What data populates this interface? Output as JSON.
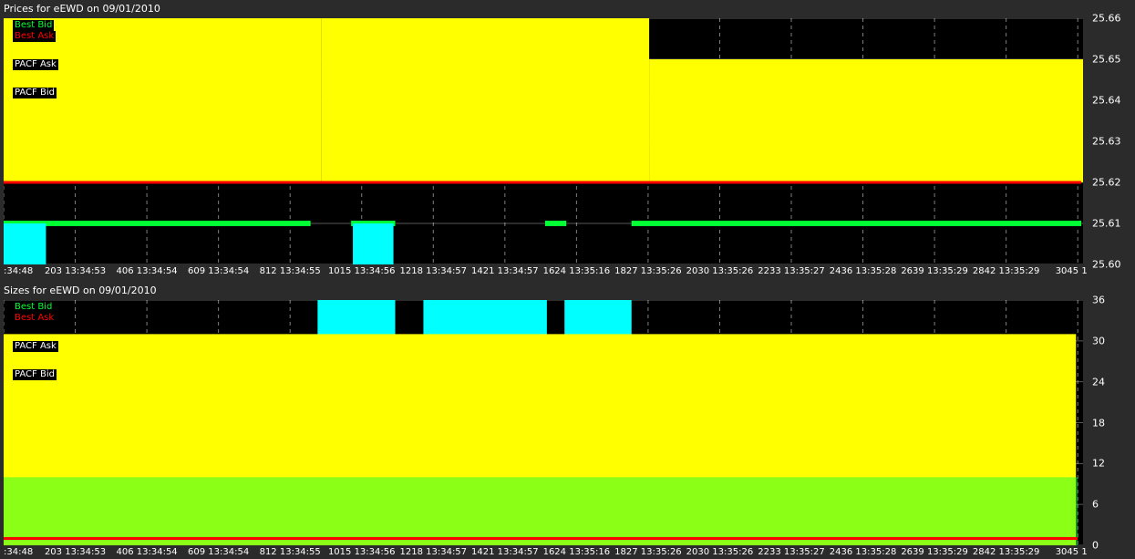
{
  "colors": {
    "ask_fill": "#ffff00",
    "bid_cyan": "#00ffff",
    "best_bid": "#00ff33",
    "best_ask": "#ff0000",
    "grid": "#ffffff",
    "background": "#000000"
  },
  "legend": [
    {
      "label": "Best Bid",
      "color": "#00ff33",
      "text": "#00ff33"
    },
    {
      "label": "Best Ask",
      "color": "#ff0000",
      "text": "#ff0000"
    },
    {
      "label": "PACF Ask",
      "color": "#ffff00",
      "text": "#ffffff"
    },
    {
      "label": "PACF Bid",
      "color": "#00ffff",
      "text": "#ffffff"
    }
  ],
  "chart_data": [
    {
      "type": "area",
      "title": "Prices for  eEWD  on  09/01/2010",
      "xlabel": "",
      "ylabel": "",
      "x_range": [
        0,
        3060
      ],
      "ylim": [
        25.6,
        25.66
      ],
      "yticks": [
        "25.66",
        "25.65",
        "25.64",
        "25.63",
        "25.62",
        "25.61",
        "25.60"
      ],
      "grid": true,
      "legend_position": "top-left",
      "series": [
        {
          "name": "PACF Ask",
          "segments": [
            {
              "x": [
                0,
                115
              ],
              "value": 25.66
            },
            {
              "x": [
                115,
                900
              ],
              "value": 25.66
            },
            {
              "x": [
                900,
                1830
              ],
              "value": 25.66
            },
            {
              "x": [
                1830,
                3060
              ],
              "value": 25.65
            }
          ]
        },
        {
          "name": "Best Bid",
          "segments": [
            {
              "x": [
                0,
                870
              ],
              "value": 25.61
            },
            {
              "x": [
                985,
                1110
              ],
              "value": 25.61
            },
            {
              "x": [
                1535,
                1595
              ],
              "value": 25.61
            },
            {
              "x": [
                1780,
                3055
              ],
              "value": 25.61
            }
          ]
        },
        {
          "name": "Best Ask",
          "segments": [
            {
              "x": [
                0,
                3055
              ],
              "value": 25.62
            }
          ]
        },
        {
          "name": "PACF Bid",
          "segments": [
            {
              "x": [
                0,
                120
              ],
              "value": 25.61
            },
            {
              "x": [
                990,
                1105
              ],
              "value": 25.61
            }
          ]
        }
      ],
      "x_ticks": [
        {
          "x": 0,
          "label": ":34:48"
        },
        {
          "x": 203,
          "label": "203 13:34:53"
        },
        {
          "x": 406,
          "label": "406 13:34:54"
        },
        {
          "x": 609,
          "label": "609 13:34:54"
        },
        {
          "x": 812,
          "label": "812 13:34:55"
        },
        {
          "x": 1015,
          "label": "1015 13:34:56"
        },
        {
          "x": 1218,
          "label": "1218 13:34:57"
        },
        {
          "x": 1421,
          "label": "1421 13:34:57"
        },
        {
          "x": 1624,
          "label": "1624 13:35:16"
        },
        {
          "x": 1827,
          "label": "1827 13:35:26"
        },
        {
          "x": 2030,
          "label": "2030 13:35:26"
        },
        {
          "x": 2233,
          "label": "2233 13:35:27"
        },
        {
          "x": 2436,
          "label": "2436 13:35:28"
        },
        {
          "x": 2639,
          "label": "2639 13:35:29"
        },
        {
          "x": 2842,
          "label": "2842 13:35:29"
        },
        {
          "x": 3045,
          "label": "3045 1"
        }
      ]
    },
    {
      "type": "area",
      "title": "Sizes for  eEWD  on  09/01/2010",
      "xlabel": "",
      "ylabel": "",
      "x_range": [
        0,
        3060
      ],
      "ylim": [
        0,
        36
      ],
      "yticks": [
        "36",
        "30",
        "24",
        "18",
        "12",
        "6",
        "0"
      ],
      "grid": true,
      "legend_position": "top-left",
      "series": [
        {
          "name": "PACF Bid",
          "segments": [
            {
              "x": [
                890,
                1110
              ],
              "value": 36
            },
            {
              "x": [
                1190,
                1540
              ],
              "value": 36
            },
            {
              "x": [
                1590,
                1780
              ],
              "value": 36
            }
          ]
        },
        {
          "name": "PACF Ask",
          "segments": [
            {
              "x": [
                0,
                3040
              ],
              "value": 31
            }
          ]
        },
        {
          "name": "Best Bid",
          "segments": [
            {
              "x": [
                0,
                3045
              ],
              "value": 10
            }
          ]
        },
        {
          "name": "Best Ask",
          "segments": [
            {
              "x": [
                0,
                3045
              ],
              "value": 1
            }
          ]
        }
      ],
      "x_ticks": [
        {
          "x": 0,
          "label": ":34:48"
        },
        {
          "x": 203,
          "label": "203 13:34:53"
        },
        {
          "x": 406,
          "label": "406 13:34:54"
        },
        {
          "x": 609,
          "label": "609 13:34:54"
        },
        {
          "x": 812,
          "label": "812 13:34:55"
        },
        {
          "x": 1015,
          "label": "1015 13:34:56"
        },
        {
          "x": 1218,
          "label": "1218 13:34:57"
        },
        {
          "x": 1421,
          "label": "1421 13:34:57"
        },
        {
          "x": 1624,
          "label": "1624 13:35:16"
        },
        {
          "x": 1827,
          "label": "1827 13:35:26"
        },
        {
          "x": 2030,
          "label": "2030 13:35:26"
        },
        {
          "x": 2233,
          "label": "2233 13:35:27"
        },
        {
          "x": 2436,
          "label": "2436 13:35:28"
        },
        {
          "x": 2639,
          "label": "2639 13:35:29"
        },
        {
          "x": 2842,
          "label": "2842 13:35:29"
        },
        {
          "x": 3045,
          "label": "3045 1"
        }
      ]
    }
  ]
}
